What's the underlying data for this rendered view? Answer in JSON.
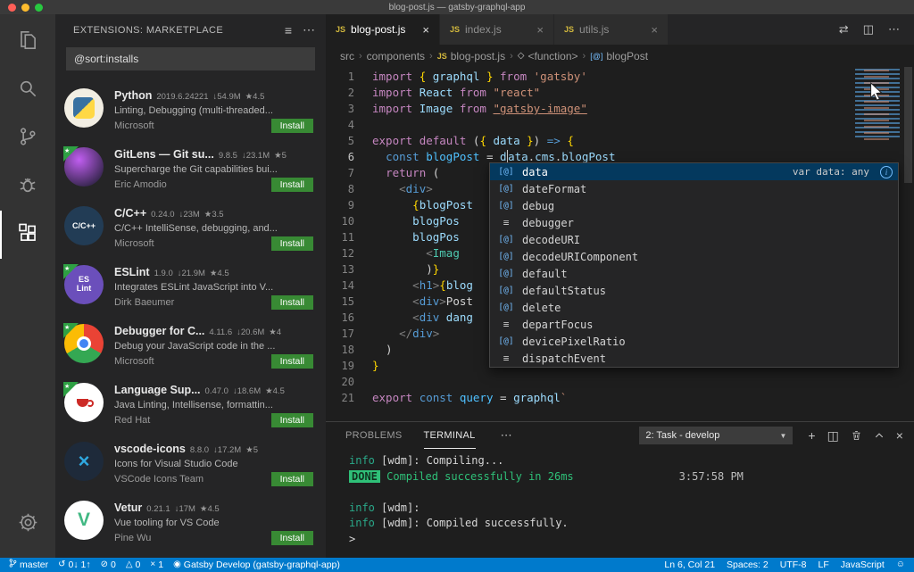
{
  "title_bar": {
    "title": "blog-post.js — gatsby-graphql-app"
  },
  "activity_bar": {
    "icons": [
      "files-icon",
      "search-icon",
      "source-control-icon",
      "debug-icon",
      "extensions-icon",
      "settings-gear-icon"
    ],
    "active": "extensions-icon"
  },
  "sidebar": {
    "header": {
      "title": "EXTENSIONS: MARKETPLACE",
      "filter_icon": "≡",
      "more_icon": "⋯"
    },
    "search": {
      "value": "@sort:installs"
    },
    "extensions": [
      {
        "name": "Python",
        "version": "2019.6.24221",
        "downloads": "54.9M",
        "rating": "4.5",
        "description": "Linting, Debugging (multi-threaded...",
        "publisher": "Microsoft",
        "action": "Install",
        "flag": false,
        "logo": "python",
        "logo_text": ""
      },
      {
        "name": "GitLens — Git su...",
        "version": "9.8.5",
        "downloads": "23.1M",
        "rating": "5",
        "description": "Supercharge the Git capabilities bui...",
        "publisher": "Eric Amodio",
        "action": "Install",
        "flag": true,
        "logo": "gitlens",
        "logo_text": ""
      },
      {
        "name": "C/C++",
        "version": "0.24.0",
        "downloads": "23M",
        "rating": "3.5",
        "description": "C/C++ IntelliSense, debugging, and...",
        "publisher": "Microsoft",
        "action": "Install",
        "flag": false,
        "logo": "cpp",
        "logo_text": "C/C++"
      },
      {
        "name": "ESLint",
        "version": "1.9.0",
        "downloads": "21.9M",
        "rating": "4.5",
        "description": "Integrates ESLint JavaScript into V...",
        "publisher": "Dirk Baeumer",
        "action": "Install",
        "flag": true,
        "logo": "eslint",
        "logo_text": "ES Lint"
      },
      {
        "name": "Debugger for C...",
        "version": "4.11.6",
        "downloads": "20.6M",
        "rating": "4",
        "description": "Debug your JavaScript code in the ...",
        "publisher": "Microsoft",
        "action": "Install",
        "flag": true,
        "logo": "chrome",
        "logo_text": ""
      },
      {
        "name": "Language Sup...",
        "version": "0.47.0",
        "downloads": "18.6M",
        "rating": "4.5",
        "description": "Java Linting, Intellisense, formattin...",
        "publisher": "Red Hat",
        "action": "Install",
        "flag": true,
        "logo": "redhat",
        "logo_text": ""
      },
      {
        "name": "vscode-icons",
        "version": "8.8.0",
        "downloads": "17.2M",
        "rating": "5",
        "description": "Icons for Visual Studio Code",
        "publisher": "VSCode Icons Team",
        "action": "Install",
        "flag": false,
        "logo": "vsicons",
        "logo_text": "×"
      },
      {
        "name": "Vetur",
        "version": "0.21.1",
        "downloads": "17M",
        "rating": "4.5",
        "description": "Vue tooling for VS Code",
        "publisher": "Pine Wu",
        "action": "Install",
        "flag": false,
        "logo": "vetur",
        "logo_text": "V"
      }
    ]
  },
  "editor": {
    "tabs": [
      {
        "label": "blog-post.js",
        "icon": "JS",
        "close": "×",
        "active": true
      },
      {
        "label": "index.js",
        "icon": "JS",
        "close": "×",
        "active": false
      },
      {
        "label": "utils.js",
        "icon": "JS",
        "close": "×",
        "active": false
      }
    ],
    "tab_actions": [
      {
        "name": "open-changes-icon",
        "glyph": "⇄"
      },
      {
        "name": "split-editor-icon",
        "glyph": "◫"
      },
      {
        "name": "more-actions-icon",
        "glyph": "⋯"
      }
    ],
    "breadcrumbs": [
      {
        "label": "src"
      },
      {
        "label": "components"
      },
      {
        "label": "blog-post.js",
        "glyph": "JS",
        "glyph_class": "js",
        "icon": "js-file-icon"
      },
      {
        "label": "<function>",
        "glyph": "◇",
        "icon": "symbol-function-icon"
      },
      {
        "label": "blogPost",
        "glyph": "[@]",
        "glyph_class": "at",
        "icon": "symbol-variable-icon"
      }
    ],
    "lines": [
      {
        "n": "1",
        "segs": [
          {
            "t": "import ",
            "c": "kw"
          },
          {
            "t": "{ ",
            "c": "brk"
          },
          {
            "t": "graphql",
            "c": "var"
          },
          {
            "t": " } ",
            "c": "brk"
          },
          {
            "t": "from ",
            "c": "kw"
          },
          {
            "t": "'gatsby'",
            "c": "str"
          }
        ]
      },
      {
        "n": "2",
        "segs": [
          {
            "t": "import ",
            "c": "kw"
          },
          {
            "t": "React",
            "c": "var"
          },
          {
            "t": " from ",
            "c": "kw"
          },
          {
            "t": "\"react\"",
            "c": "str"
          }
        ]
      },
      {
        "n": "3",
        "segs": [
          {
            "t": "import ",
            "c": "kw"
          },
          {
            "t": "Image",
            "c": "var"
          },
          {
            "t": " from ",
            "c": "kw"
          },
          {
            "t": "\"gatsby-image\"",
            "c": "str",
            "u": true
          }
        ]
      },
      {
        "n": "4",
        "segs": []
      },
      {
        "n": "5",
        "segs": [
          {
            "t": "export ",
            "c": "kw"
          },
          {
            "t": "default",
            "c": "kw"
          },
          {
            "t": " (",
            "c": "punc"
          },
          {
            "t": "{ ",
            "c": "brk"
          },
          {
            "t": "data",
            "c": "var"
          },
          {
            "t": " }",
            "c": "brk"
          },
          {
            "t": ") ",
            "c": "punc"
          },
          {
            "t": "=>",
            "c": "kw2"
          },
          {
            "t": " {",
            "c": "brk"
          }
        ]
      },
      {
        "n": "6",
        "current": true,
        "segs": [
          {
            "t": "  ",
            "c": "punc"
          },
          {
            "t": "const",
            "c": "kw2"
          },
          {
            "t": " ",
            "c": "punc"
          },
          {
            "t": "blogPost",
            "c": "var2"
          },
          {
            "t": " = ",
            "c": "punc"
          },
          {
            "t": "d",
            "c": "var"
          },
          {
            "cursor": true
          },
          {
            "t": "ata",
            "c": "var"
          },
          {
            "t": ".",
            "c": "punc"
          },
          {
            "t": "cms",
            "c": "var"
          },
          {
            "t": ".",
            "c": "punc"
          },
          {
            "t": "blogPost",
            "c": "var"
          }
        ]
      },
      {
        "n": "7",
        "segs": [
          {
            "t": "  ",
            "c": "punc"
          },
          {
            "t": "return",
            "c": "kw"
          },
          {
            "t": " (",
            "c": "punc"
          }
        ]
      },
      {
        "n": "8",
        "segs": [
          {
            "t": "    ",
            "c": "punc"
          },
          {
            "t": "<",
            "c": "ang"
          },
          {
            "t": "div",
            "c": "tag"
          },
          {
            "t": ">",
            "c": "ang"
          }
        ]
      },
      {
        "n": "9",
        "segs": [
          {
            "t": "      ",
            "c": "punc"
          },
          {
            "t": "{",
            "c": "brk"
          },
          {
            "t": "blogPost",
            "c": "var"
          }
        ]
      },
      {
        "n": "10",
        "segs": [
          {
            "t": "      ",
            "c": "punc"
          },
          {
            "t": "blogPos",
            "c": "var"
          }
        ]
      },
      {
        "n": "11",
        "segs": [
          {
            "t": "      ",
            "c": "punc"
          },
          {
            "t": "blogPos",
            "c": "var"
          }
        ]
      },
      {
        "n": "12",
        "segs": [
          {
            "t": "        ",
            "c": "punc"
          },
          {
            "t": "<",
            "c": "ang"
          },
          {
            "t": "Imag",
            "c": "cmp"
          }
        ]
      },
      {
        "n": "13",
        "segs": [
          {
            "t": "        )",
            "c": "punc"
          },
          {
            "t": "}",
            "c": "brk"
          }
        ]
      },
      {
        "n": "14",
        "segs": [
          {
            "t": "      ",
            "c": "punc"
          },
          {
            "t": "<",
            "c": "ang"
          },
          {
            "t": "h1",
            "c": "tag"
          },
          {
            "t": ">",
            "c": "ang"
          },
          {
            "t": "{",
            "c": "brk"
          },
          {
            "t": "blog",
            "c": "var"
          }
        ]
      },
      {
        "n": "15",
        "segs": [
          {
            "t": "      ",
            "c": "punc"
          },
          {
            "t": "<",
            "c": "ang"
          },
          {
            "t": "div",
            "c": "tag"
          },
          {
            "t": ">",
            "c": "ang"
          },
          {
            "t": "Post",
            "c": "txt"
          }
        ]
      },
      {
        "n": "16",
        "segs": [
          {
            "t": "      ",
            "c": "punc"
          },
          {
            "t": "<",
            "c": "ang"
          },
          {
            "t": "div",
            "c": "tag"
          },
          {
            "t": " dang",
            "c": "var"
          }
        ]
      },
      {
        "n": "17",
        "segs": [
          {
            "t": "    ",
            "c": "punc"
          },
          {
            "t": "</",
            "c": "ang"
          },
          {
            "t": "div",
            "c": "tag"
          },
          {
            "t": ">",
            "c": "ang"
          }
        ]
      },
      {
        "n": "18",
        "segs": [
          {
            "t": "  )",
            "c": "punc"
          }
        ]
      },
      {
        "n": "19",
        "segs": [
          {
            "t": "}",
            "c": "brk"
          }
        ]
      },
      {
        "n": "20",
        "segs": []
      },
      {
        "n": "21",
        "segs": [
          {
            "t": "export ",
            "c": "kw"
          },
          {
            "t": "const",
            "c": "kw2"
          },
          {
            "t": " ",
            "c": "punc"
          },
          {
            "t": "query",
            "c": "var2"
          },
          {
            "t": " = ",
            "c": "punc"
          },
          {
            "t": "graphql",
            "c": "var"
          },
          {
            "t": "`",
            "c": "str"
          }
        ]
      }
    ],
    "suggest": {
      "items": [
        {
          "label": "data",
          "icon": "[@]",
          "kind": "var",
          "selected": true,
          "detail": "var data: any",
          "info": "i"
        },
        {
          "label": "dateFormat",
          "icon": "[@]",
          "kind": "var"
        },
        {
          "label": "debug",
          "icon": "[@]",
          "kind": "var"
        },
        {
          "label": "debugger",
          "icon": "≡",
          "kind": "kw"
        },
        {
          "label": "decodeURI",
          "icon": "[@]",
          "kind": "var"
        },
        {
          "label": "decodeURIComponent",
          "icon": "[@]",
          "kind": "var"
        },
        {
          "label": "default",
          "icon": "[@]",
          "kind": "var"
        },
        {
          "label": "defaultStatus",
          "icon": "[@]",
          "kind": "var"
        },
        {
          "label": "delete",
          "icon": "[@]",
          "kind": "var"
        },
        {
          "label": "departFocus",
          "icon": "≡",
          "kind": "kw"
        },
        {
          "label": "devicePixelRatio",
          "icon": "[@]",
          "kind": "var"
        },
        {
          "label": "dispatchEvent",
          "icon": "≡",
          "kind": "kw"
        }
      ]
    }
  },
  "panel": {
    "tabs": [
      {
        "label": "PROBLEMS",
        "active": false
      },
      {
        "label": "TERMINAL",
        "active": true
      }
    ],
    "more_icon": "⋯",
    "task_select": {
      "value": "2: Task - develop",
      "caret": "▼"
    },
    "actions": [
      {
        "name": "new-terminal-icon",
        "glyph": "+"
      },
      {
        "name": "split-terminal-icon",
        "glyph": "◫"
      },
      {
        "name": "kill-terminal-icon",
        "glyph": "svg:trash"
      },
      {
        "name": "maximize-panel-icon",
        "glyph": "svg:chevron"
      },
      {
        "name": "close-panel-icon",
        "glyph": "×"
      }
    ],
    "terminal": {
      "lines": [
        {
          "segs": [
            {
              "t": "info",
              "c": "t-info"
            },
            {
              "t": " [wdm]: ",
              "c": "t-dim"
            },
            {
              "t": "Compiling...",
              "c": "t-dim"
            }
          ]
        },
        {
          "segs": [
            {
              "t": "DONE",
              "c": "t-badge"
            },
            {
              "t": " Compiled successfully in 26ms",
              "c": "t-green"
            },
            {
              "t": "3:57:58 PM",
              "c": "t-time",
              "ml": 118
            }
          ]
        },
        {
          "segs": []
        },
        {
          "segs": [
            {
              "t": "info",
              "c": "t-info"
            },
            {
              "t": " [wdm]: ",
              "c": "t-dim"
            }
          ]
        },
        {
          "segs": [
            {
              "t": "info",
              "c": "t-info"
            },
            {
              "t": " [wdm]: ",
              "c": "t-dim"
            },
            {
              "t": "Compiled successfully.",
              "c": "t-dim"
            }
          ]
        },
        {
          "segs": [
            {
              "t": ">",
              "c": "t-dim"
            }
          ]
        }
      ]
    }
  },
  "status_bar": {
    "left": [
      {
        "icon": "git-branch-icon",
        "glyph": "svg:branch",
        "text": "master"
      },
      {
        "icon": "sync-icon",
        "glyph": "↺",
        "text": "0↓ 1↑"
      },
      {
        "icon": "errors-icon",
        "glyph": "⊘",
        "text": "0"
      },
      {
        "icon": "warnings-icon",
        "glyph": "△",
        "text": "0"
      },
      {
        "icon": "close-icon",
        "glyph": "×",
        "text": "1"
      },
      {
        "icon": "gatsby-task-icon",
        "glyph": "◉",
        "text": "Gatsby Develop (gatsby-graphql-app)"
      }
    ],
    "right": [
      {
        "text": "Ln 6, Col 21"
      },
      {
        "text": "Spaces: 2"
      },
      {
        "text": "UTF-8"
      },
      {
        "text": "LF"
      },
      {
        "text": "JavaScript"
      },
      {
        "icon": "feedback-smiley-icon",
        "glyph": "☺",
        "text": ""
      }
    ]
  }
}
